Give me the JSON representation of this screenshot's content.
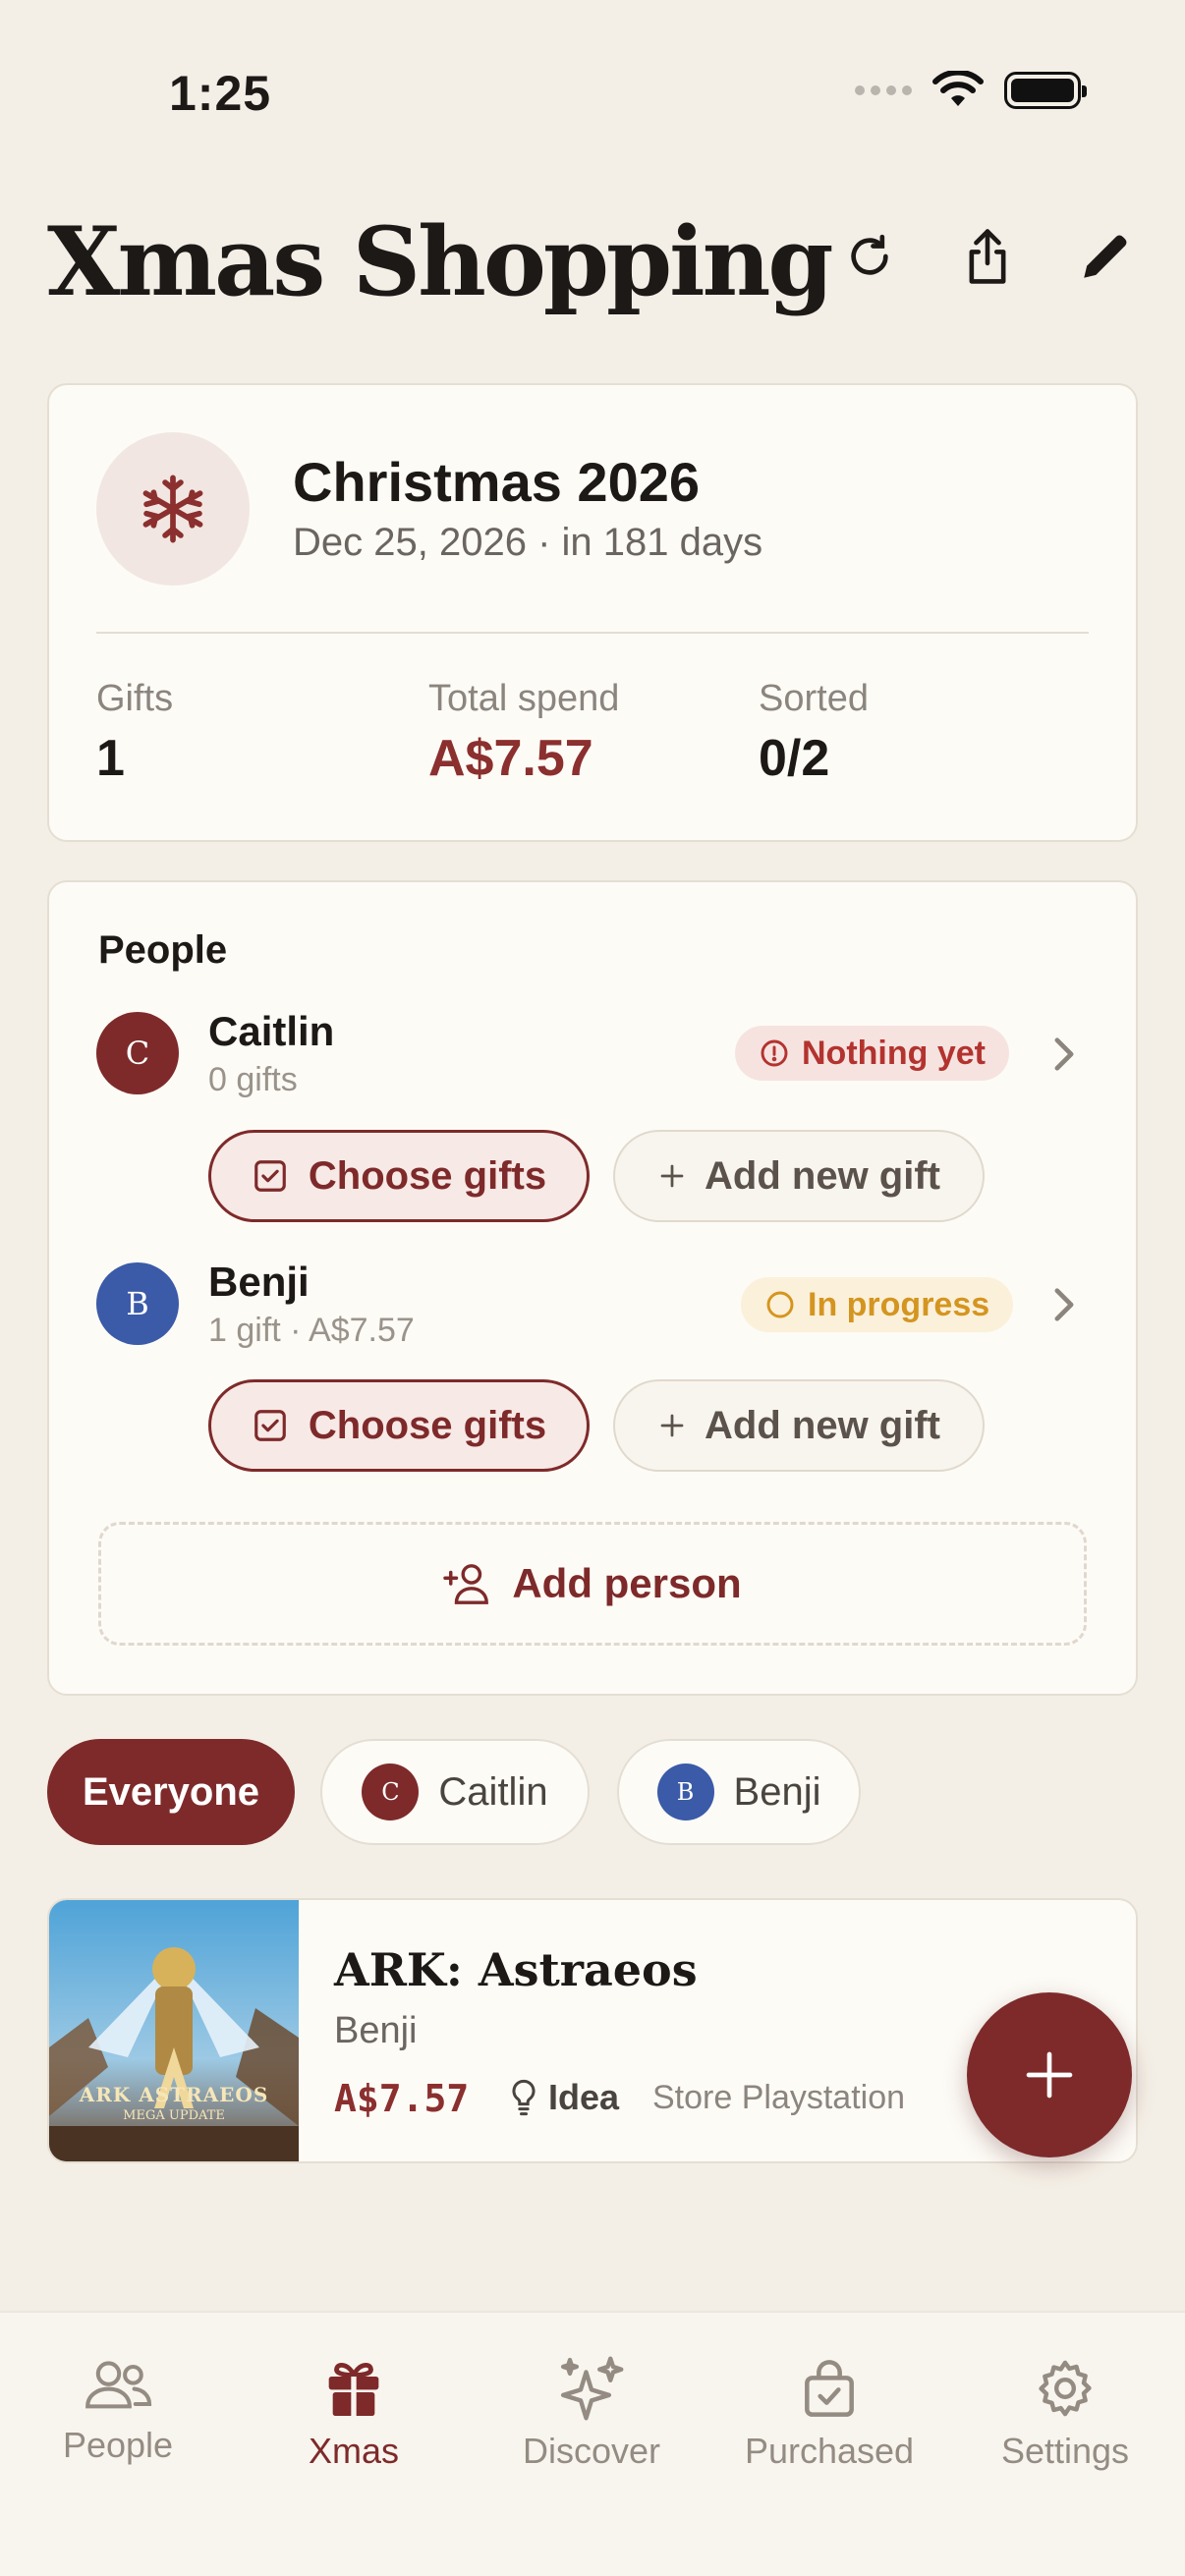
{
  "status": {
    "time": "1:25"
  },
  "header": {
    "title": "Xmas Shopping"
  },
  "event": {
    "title": "Christmas 2026",
    "subtitle": "Dec 25, 2026 · in 181 days",
    "stats": [
      {
        "label": "Gifts",
        "value": "1"
      },
      {
        "label": "Total spend",
        "value": "A$7.57"
      },
      {
        "label": "Sorted",
        "value": "0/2"
      }
    ]
  },
  "people": {
    "title": "People",
    "list": [
      {
        "initial": "C",
        "name": "Caitlin",
        "sub": "0 gifts",
        "badge": "Nothing yet",
        "choose": "Choose gifts",
        "add": "Add new gift",
        "color": "#7e2a2a"
      },
      {
        "initial": "B",
        "name": "Benji",
        "sub": "1 gift · A$7.57",
        "badge": "In progress",
        "choose": "Choose gifts",
        "add": "Add new gift",
        "color": "#3b5aa8"
      }
    ],
    "add_person": "Add person"
  },
  "filters": [
    {
      "label": "Everyone"
    },
    {
      "initial": "C",
      "label": "Caitlin"
    },
    {
      "initial": "B",
      "label": "Benji"
    }
  ],
  "gift": {
    "title": "ARK: Astraeos",
    "person": "Benji",
    "price": "A$7.57",
    "status": "Idea",
    "store": "Store Playstation",
    "thumb_text": "ARK ASTRAEOS",
    "thumb_sub": "MEGA UPDATE"
  },
  "tabs": [
    {
      "label": "People",
      "icon": "people-icon"
    },
    {
      "label": "Xmas",
      "icon": "gift-icon"
    },
    {
      "label": "Discover",
      "icon": "sparkles-icon"
    },
    {
      "label": "Purchased",
      "icon": "bag-check-icon"
    },
    {
      "label": "Settings",
      "icon": "gear-icon"
    }
  ],
  "colors": {
    "accent": "#7e2a2a",
    "background": "#f4efe6",
    "card": "#fdfbf6",
    "benji": "#3b5aa8",
    "amber": "#d49520"
  }
}
